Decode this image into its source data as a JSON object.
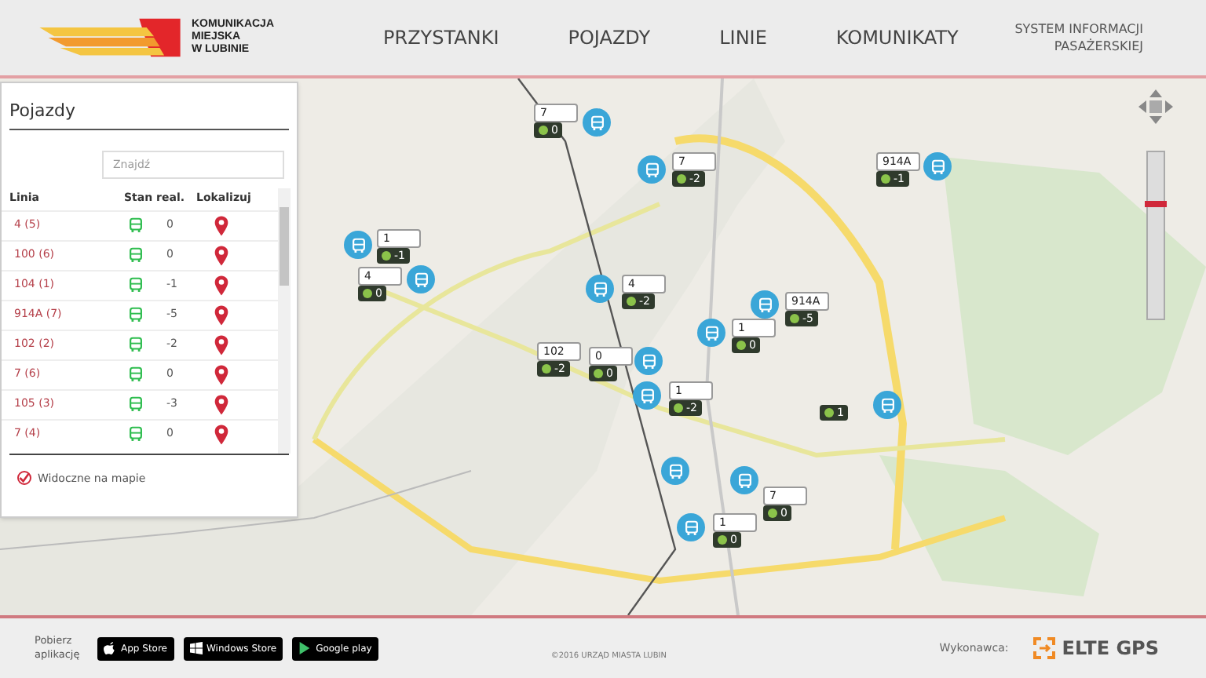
{
  "header": {
    "logo_text": [
      "KOMUNIKACJA",
      "MIEJSKA",
      "W LUBINIE"
    ],
    "nav": [
      {
        "label": "PRZYSTANKI"
      },
      {
        "label": "POJAZDY"
      },
      {
        "label": "LINIE"
      },
      {
        "label": "KOMUNIKATY"
      }
    ],
    "system_title": [
      "SYSTEM INFORMACJI",
      "PASAŻERSKIEJ"
    ]
  },
  "zoom": {
    "level": 0.7
  },
  "sidebar": {
    "title": "Pojazdy",
    "search": {
      "placeholder": "Znajdź"
    },
    "columns": [
      "Linia",
      "Stan real.",
      "Lokalizuj"
    ],
    "rows": [
      {
        "line": "4 (5)",
        "delay": "0"
      },
      {
        "line": "100 (6)",
        "delay": "0"
      },
      {
        "line": "104 (1)",
        "delay": "-1"
      },
      {
        "line": "914A (7)",
        "delay": "-5"
      },
      {
        "line": "102 (2)",
        "delay": "-2"
      },
      {
        "line": "7 (6)",
        "delay": "0"
      },
      {
        "line": "105 (3)",
        "delay": "-3"
      },
      {
        "line": "7 (4)",
        "delay": "0"
      }
    ],
    "visible_on_map": {
      "label": "Widoczne na mapie",
      "checked": true
    }
  },
  "map": {
    "markers": [
      {
        "line": "7",
        "delay": "0"
      },
      {
        "line": "7",
        "delay": "-2"
      },
      {
        "line": "914A",
        "delay": "-1"
      },
      {
        "line": "1",
        "delay": "-1"
      },
      {
        "line": "4",
        "delay": "0"
      },
      {
        "line": "4",
        "delay": "-2"
      },
      {
        "line": "914A",
        "delay": "-5"
      },
      {
        "line": "1",
        "delay": "0"
      },
      {
        "line": "102",
        "delay": "-2"
      },
      {
        "line": "0",
        "delay": "0"
      },
      {
        "line": "1",
        "delay": "-2"
      },
      {
        "delay": "1"
      },
      {
        "line": "7",
        "delay": "0"
      },
      {
        "line": "1",
        "delay": "0"
      }
    ]
  },
  "footer": {
    "download_label": [
      "Pobierz",
      "aplikację"
    ],
    "stores": [
      {
        "kind": "apple",
        "label": "App Store"
      },
      {
        "kind": "windows",
        "label": "Windows Store"
      },
      {
        "kind": "google",
        "label": "Google play"
      }
    ],
    "copyright": "©2016 URZĄD MIASTA LUBIN",
    "contractor_label": "Wykonawca:",
    "contractor": "ELTE GPS"
  }
}
